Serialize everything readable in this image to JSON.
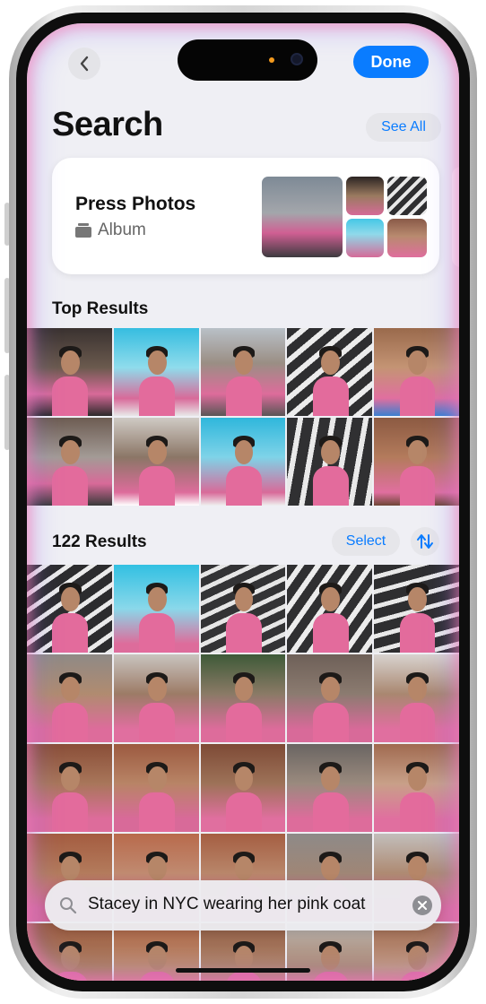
{
  "header": {
    "done_label": "Done",
    "title": "Search",
    "see_all_label": "See All"
  },
  "album": {
    "title": "Press Photos",
    "subtitle": "Album",
    "icon": "album-stack-icon"
  },
  "top_results": {
    "title": "Top Results",
    "thumbnail_count": 10
  },
  "results": {
    "title": "122 Results",
    "select_label": "Select",
    "sort_icon": "sort-arrows-icon"
  },
  "search": {
    "query": "Stacey in NYC wearing her pink coat",
    "icon": "search-icon",
    "clear_icon": "clear-icon"
  },
  "colors": {
    "accent": "#0a7cff",
    "coat_pink": "#e36b9c",
    "background": "#efeff4"
  }
}
